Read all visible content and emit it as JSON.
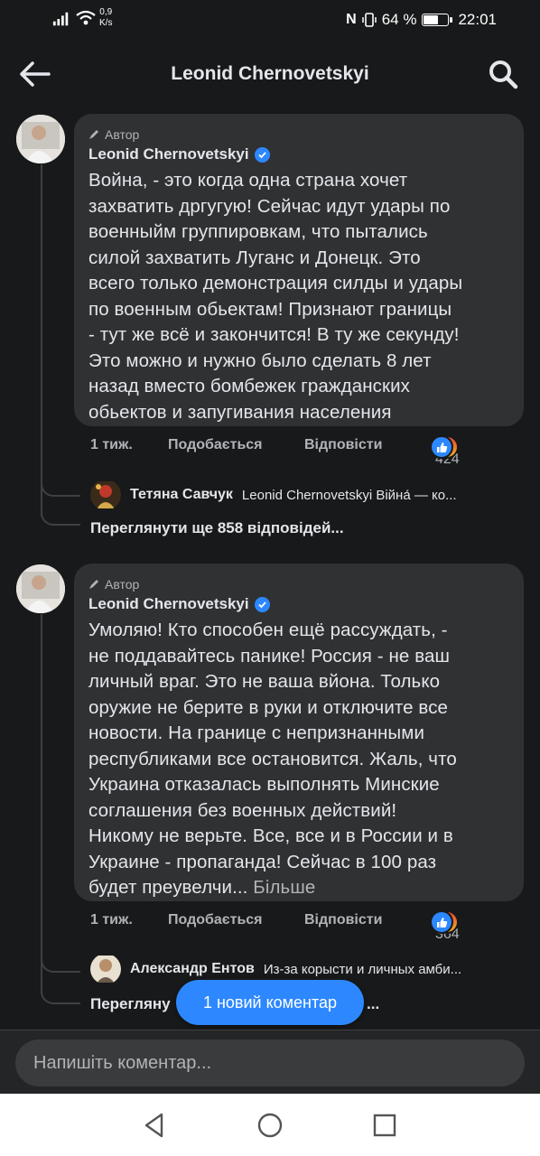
{
  "status_bar": {
    "network_speed_value": "0,9",
    "network_speed_unit": "K/s",
    "battery_percent": "64 %",
    "battery_level": 0.64,
    "time": "22:01"
  },
  "header": {
    "title": "Leonid Chernovetskyi"
  },
  "colors": {
    "background": "#18191a",
    "bubble": "#303133",
    "accent": "#2d88ff",
    "muted": "#b0b3b8"
  },
  "comments": [
    {
      "author_tag": "Автор",
      "author": "Leonid Chernovetskyi",
      "lines": [
        "Война, - это когда одна страна хочет",
        "захватить дргугую! Сейчас идут удары по",
        "военныйм группировкам, что пытались",
        "силой захватить Луганс и Донецк. Это",
        "всего только демонстрация силды и удары",
        "по военным обьектам!  Признают границы",
        "- тут же всё и  закончится! В ту же секунду!",
        "Это можно и нужно было сделать 8 лет",
        "назад вместо бомбежек гражданских",
        "обьектов и запугивания населения"
      ],
      "time": "1 тиж.",
      "like_label": "Подобається",
      "reply_label": "Відповісти",
      "reaction_count": "1 424",
      "reply_preview": {
        "author": "Тетяна Савчук",
        "text": "Leonid Chernovetskyi Війна́ — ко..."
      },
      "view_more": "Переглянути ще 858 відповідей..."
    },
    {
      "author_tag": "Автор",
      "author": "Leonid Chernovetskyi",
      "lines": [
        "Умоляю! Кто способен ещё рассуждать, -",
        "не поддавайтесь панике! Россия - не ваш",
        "личный враг. Это не ваша вйона. Только",
        "оружие не берите в руки и отключите все",
        "новости. На границе с непризнанными",
        "республиками все остановится. Жаль, что",
        "Украина отказалась выполнять Минские",
        "соглашения без военных действий!",
        "Никому не верьте. Все, все и в России и в",
        "Украине - пропаганда! Сейчас в 100 раз"
      ],
      "last_line": "будет преувелчи...",
      "more_label": "Більше",
      "time": "1 тиж.",
      "like_label": "Подобається",
      "reply_label": "Відповісти",
      "reaction_count": "1 364",
      "reply_preview": {
        "author": "Александр Ентов",
        "text": "Из-за корысти и личных амби..."
      },
      "view_more_visible": "Перегляну",
      "view_more_tail": "..."
    }
  ],
  "new_comment_pill": "1 новий коментар",
  "composer": {
    "placeholder": "Напишіть коментар..."
  },
  "nav_bar": {
    "icons": [
      "back-triangle-icon",
      "home-circle-icon",
      "recents-square-icon"
    ]
  }
}
